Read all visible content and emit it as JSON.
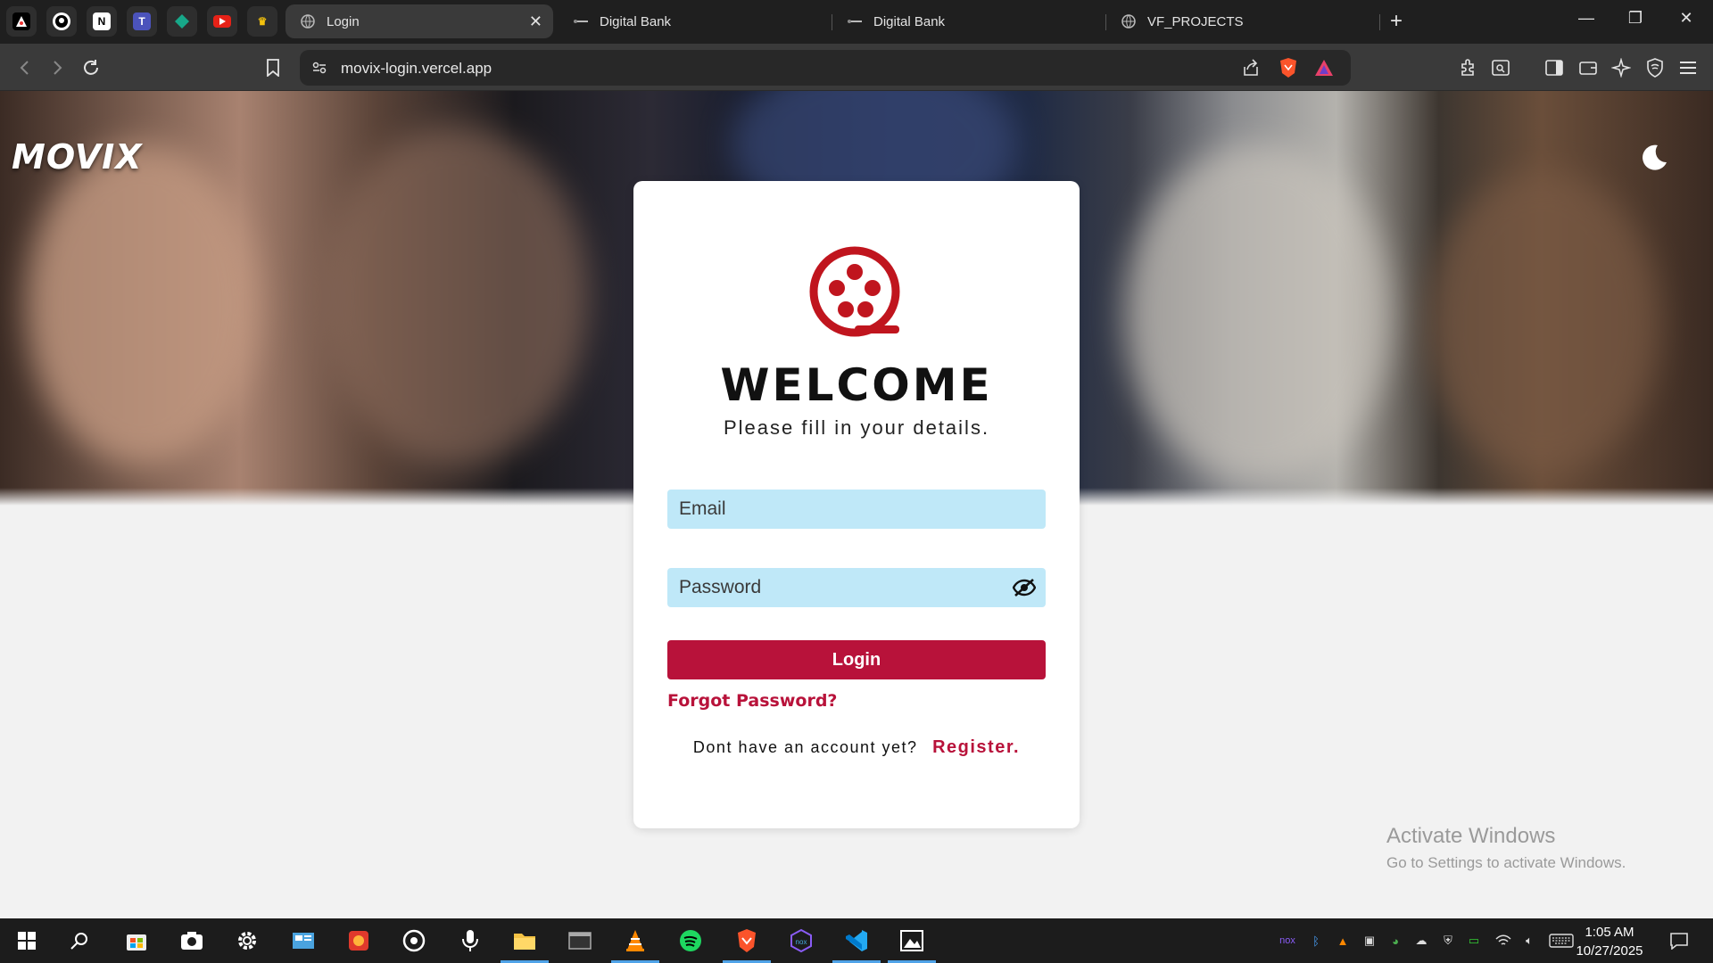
{
  "browser": {
    "tabs": [
      {
        "label": "Login",
        "active": true
      },
      {
        "label": "Digital Bank",
        "active": false
      },
      {
        "label": "Digital Bank",
        "active": false
      },
      {
        "label": "VF_PROJECTS",
        "active": false
      }
    ],
    "pinned_tabs": [
      "app-icon",
      "github-icon",
      "notion-icon",
      "teams-icon",
      "diamond-icon",
      "youtube-icon",
      "crown-icon"
    ],
    "url": "movix-login.vercel.app",
    "notification_count": "1"
  },
  "site": {
    "logo": "MOVIX"
  },
  "login": {
    "title": "WELCOME",
    "subtitle": "Please fill in your details.",
    "email_placeholder": "Email",
    "password_placeholder": "Password",
    "login_label": "Login",
    "forgot_label": "Forgot Password?",
    "no_account_text": "Dont have an account yet?",
    "register_label": "Register."
  },
  "watermark": {
    "line1": "Activate Windows",
    "line2": "Go to Settings to activate Windows."
  },
  "taskbar": {
    "time": "1:05 AM",
    "date": "10/27/2025"
  },
  "colors": {
    "accent": "#b8123a",
    "input_bg": "#bfe8f8",
    "reel": "#c0151e"
  }
}
